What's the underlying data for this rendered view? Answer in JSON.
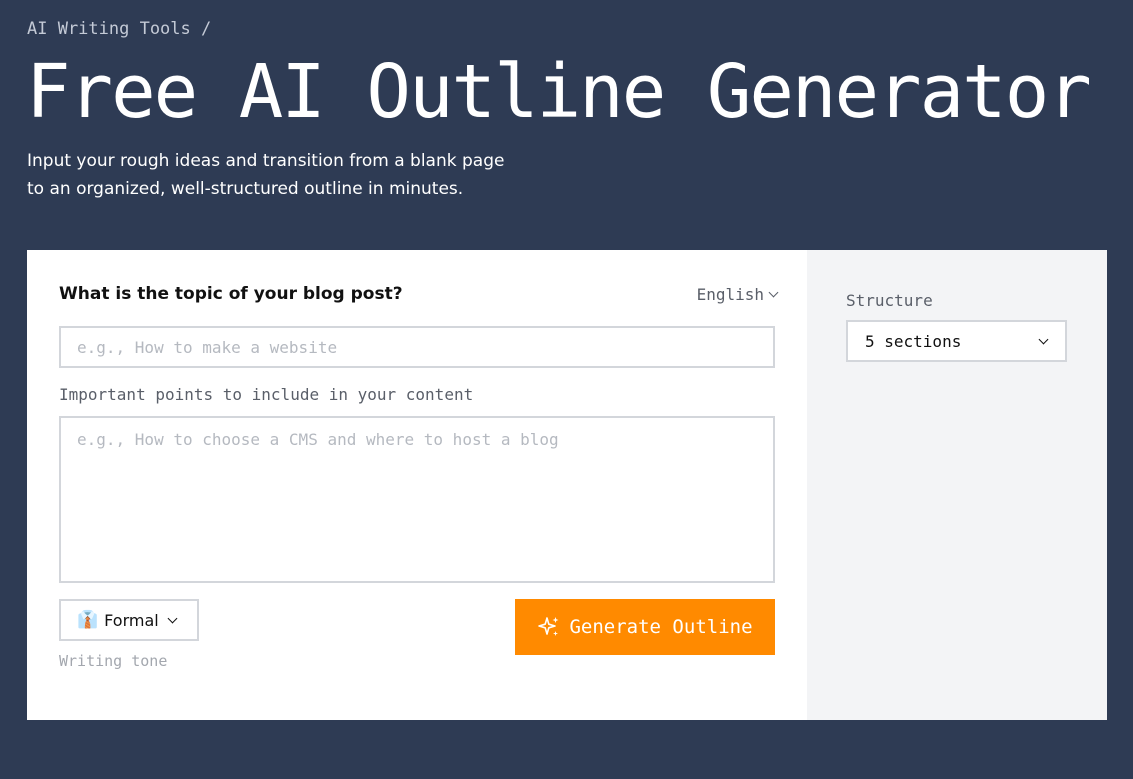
{
  "breadcrumb": "AI Writing Tools /",
  "page_title": "Free AI Outline Generator",
  "subtitle": {
    "line1": "Input your rough ideas and transition from a blank page",
    "line2": "to an organized, well-structured outline in minutes."
  },
  "form": {
    "topic_label": "What is the topic of your blog post?",
    "language": "English",
    "topic_input": {
      "value": "",
      "placeholder": "e.g., How to make a website"
    },
    "points_label": "Important points to include in your content",
    "points_input": {
      "value": "",
      "placeholder": "e.g., How to choose a CMS and where to host a blog"
    },
    "tone": {
      "value": "Formal",
      "icon": "man-office-worker-icon",
      "icon_glyph": "👔",
      "caption": "Writing tone"
    },
    "generate_button": {
      "label": "Generate Outline",
      "icon": "sparkles-icon"
    }
  },
  "side": {
    "structure_label": "Structure",
    "structure_value": "5 sections"
  },
  "colors": {
    "background": "#2e3b54",
    "card": "#ffffff",
    "side_panel": "#f3f4f6",
    "accent": "#ff8a00",
    "border": "#d3d6db"
  }
}
